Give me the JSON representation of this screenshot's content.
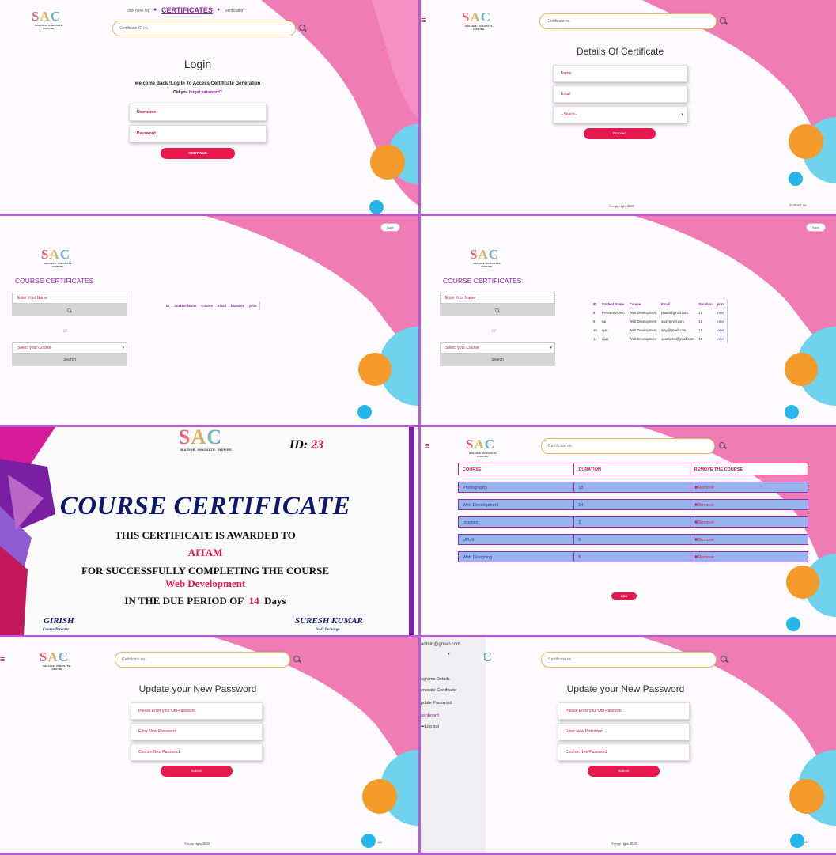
{
  "colors": {
    "accent": "#e8174d",
    "purple": "#8e24aa",
    "pink": "#f06daa",
    "cyan": "#5ad0ec",
    "orange": "#f5a623"
  },
  "logo": {
    "text": "SAC",
    "tagline": "IMAGINE. INNOVATE. INSPIRE."
  },
  "login": {
    "click_here": "click here for",
    "certificates_link": "CERTIFICATES",
    "verification": "verification",
    "search_placeholder": "Certificate ID no.",
    "title": "Login",
    "welcome": "welcome Back !Log In To Access Certificate Generation",
    "did_you": "Did you",
    "forget": "forget password?",
    "username": "Username",
    "password": "Password",
    "continue": "CONTINUE"
  },
  "details": {
    "search_placeholder": "Certificate no.",
    "title": "Details Of Certificate",
    "name": "Name",
    "email": "Email",
    "select": "--Select--",
    "proceed": "Proceed",
    "copyright": "©copy right 2020",
    "contact": "Contact us"
  },
  "course_cert_search": {
    "back": "Back",
    "title": "COURSE CERTIFICATES",
    "name_placeholder": "Enter Your Name",
    "or": "or",
    "select_course": "Select your Course",
    "search": "Search",
    "headers": [
      "ID",
      "Student Name",
      "Course",
      "Email",
      "Duration",
      "print"
    ]
  },
  "course_cert_results": {
    "back": "Back",
    "title": "COURSE CERTIFICATES",
    "name_placeholder": "Enter Your Name",
    "or": "or",
    "select_course": "Select your Course",
    "search": "Search",
    "headers": [
      "ID",
      "Student Name",
      "Course",
      "Email",
      "Duration",
      "print"
    ],
    "rows": [
      [
        "8",
        "PHANEENDRA",
        "Web Development",
        "phani@gmail.com",
        "10",
        "view"
      ],
      [
        "9",
        "sai",
        "Web Development",
        "sai@gmail.com",
        "10",
        "view"
      ],
      [
        "10",
        "ajay",
        "Web Development",
        "ajay@gmail.com",
        "10",
        "view"
      ],
      [
        "11",
        "aijas",
        "Web Development",
        "aijas1234@gmail.com",
        "10",
        "view"
      ]
    ]
  },
  "certificate": {
    "id_label": "ID:",
    "id_value": "23",
    "title": "COURSE CERTIFICATE",
    "awarded": "THIS CERTIFICATE IS AWARDED TO",
    "name": "AITAM",
    "completing": "FOR SUCCESSFULLY COMPLETING THE COURSE",
    "course": "Web Development",
    "period_pre": "IN THE DUE PERIOD OF",
    "days": "14",
    "period_post": "Days",
    "sign1_name": "GIRISH",
    "sign1_role": "Course Director",
    "sign2_name": "SURESH KUMAR",
    "sign2_role": "SAC Incharge"
  },
  "courses": {
    "search_placeholder": "Certificate no.",
    "headers": [
      "COURSE",
      "DURATION",
      "REMOVE THE COURSE"
    ],
    "rows": [
      [
        "Photography",
        "18",
        "Remove"
      ],
      [
        "Web Development",
        "14",
        "Remove"
      ],
      [
        "robotics",
        "2",
        "Remove"
      ],
      [
        "UI/UX",
        "5",
        "Remove"
      ],
      [
        "Web Designing",
        "5",
        "Remove"
      ]
    ],
    "add": "ADD"
  },
  "update_password": {
    "search_placeholder": "Certificate no.",
    "title": "Update your New Password",
    "old": "Please Enter your Old Password",
    "new": "Enter New Password",
    "confirm": "Confirm New Password",
    "submit": "Submit",
    "copyright": "©copy right 2020",
    "contact": "us"
  },
  "update_password_menu": {
    "user": "admin@gmail.com",
    "arrow": "▾",
    "menu": [
      "ograms Details",
      "enerate Certificate",
      "pdate Password",
      "ashboard",
      "Log out"
    ],
    "search_placeholder": "Certificate no.",
    "title": "Update your New Password",
    "old": "Please Enter your Old Password",
    "new": "Enter New Password",
    "confirm": "Confirm New Password",
    "submit": "Submit",
    "copyright": "©copy right 2020",
    "contact": "us"
  }
}
